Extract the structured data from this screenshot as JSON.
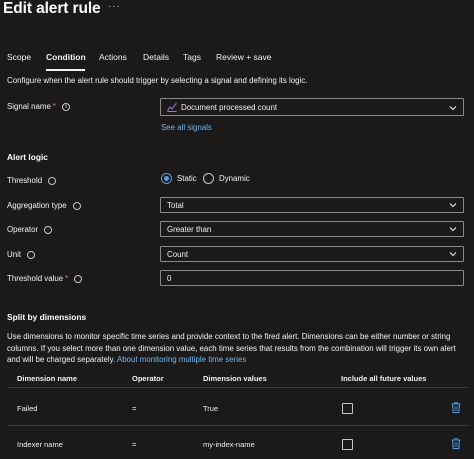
{
  "header": {
    "title": "Edit alert rule",
    "more_glyph": "···"
  },
  "tabs": [
    {
      "label": "Scope",
      "active": false
    },
    {
      "label": "Condition",
      "active": true
    },
    {
      "label": "Actions",
      "active": false
    },
    {
      "label": "Details",
      "active": false
    },
    {
      "label": "Tags",
      "active": false
    },
    {
      "label": "Review + save",
      "active": false
    }
  ],
  "condition": {
    "description": "Configure when the alert rule should trigger by selecting a signal and defining its logic.",
    "signal": {
      "label": "Signal name",
      "required_mark": "*",
      "value": "Document processed count",
      "see_all_link": "See all signals"
    },
    "alert_logic": {
      "title": "Alert logic",
      "threshold": {
        "label": "Threshold",
        "options": [
          "Static",
          "Dynamic"
        ],
        "selected": "Static"
      },
      "aggregation": {
        "label": "Aggregation type",
        "value": "Total"
      },
      "operator": {
        "label": "Operator",
        "value": "Greater than"
      },
      "unit": {
        "label": "Unit",
        "value": "Count"
      },
      "threshold_value": {
        "label": "Threshold value",
        "required_mark": "*",
        "value": "0"
      }
    },
    "split": {
      "title": "Split by dimensions",
      "description": "Use dimensions to monitor specific time series and provide context to the fired alert. Dimensions can be either number or string columns. If you select more than one dimension value, each time series that results from the combination will trigger its own alert and will be charged separately.",
      "link": "About monitoring multiple time series",
      "columns": [
        "Dimension name",
        "Operator",
        "Dimension values",
        "Include all future values"
      ],
      "rows": [
        {
          "name": "Failed",
          "operator": "=",
          "values": "True",
          "include_future": false
        },
        {
          "name": "Indexer name",
          "operator": "=",
          "values": "my-index-name",
          "include_future": false
        }
      ]
    }
  },
  "colors": {
    "background": "#1b1a19",
    "link": "#6cb8f6",
    "accent": "#4f9ee8",
    "danger": "#f1707b",
    "border": "#8a8886"
  },
  "icons": {
    "more": "more-icon",
    "info": "info-icon",
    "dropdown": "chevron-down-icon",
    "signal": "metric-signal-icon",
    "delete": "trash-icon"
  }
}
